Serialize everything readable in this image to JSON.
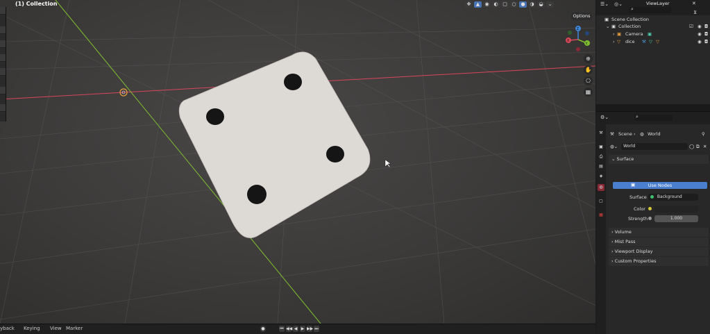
{
  "viewport": {
    "title": "(1) Collection",
    "options_label": "Options",
    "nav_icons": [
      "zoom-icon",
      "hand-icon",
      "camera-icon",
      "grid-icon"
    ],
    "gizmo": {
      "x_label": "X",
      "y_label": "Y",
      "z_label": "Z"
    }
  },
  "timeline": {
    "playback_label": "yback",
    "keying_label": "Keying",
    "view_label": "View",
    "marker_label": "Marker"
  },
  "outliner": {
    "view_layer_label": "ViewLayer",
    "items": [
      {
        "label": "Scene Collection"
      },
      {
        "label": "Collection"
      },
      {
        "label": "Camera"
      },
      {
        "label": "dice"
      }
    ]
  },
  "properties": {
    "breadcrumb_scene": "Scene",
    "breadcrumb_world": "World",
    "world_name": "World",
    "surface_header": "Surface",
    "use_nodes_label": "Use Nodes",
    "surface_label": "Surface",
    "surface_value": "Background",
    "color_label": "Color",
    "strength_label": "Strength",
    "strength_value": "1.000",
    "panels": [
      "Volume",
      "Mist Pass",
      "Viewport Display",
      "Custom Properties"
    ]
  },
  "colors": {
    "accent": "#4a7fcf",
    "x_axis": "#d9475a",
    "y_axis": "#7fbf2f",
    "z_axis": "#3f86d9",
    "origin": "#e8a040"
  }
}
